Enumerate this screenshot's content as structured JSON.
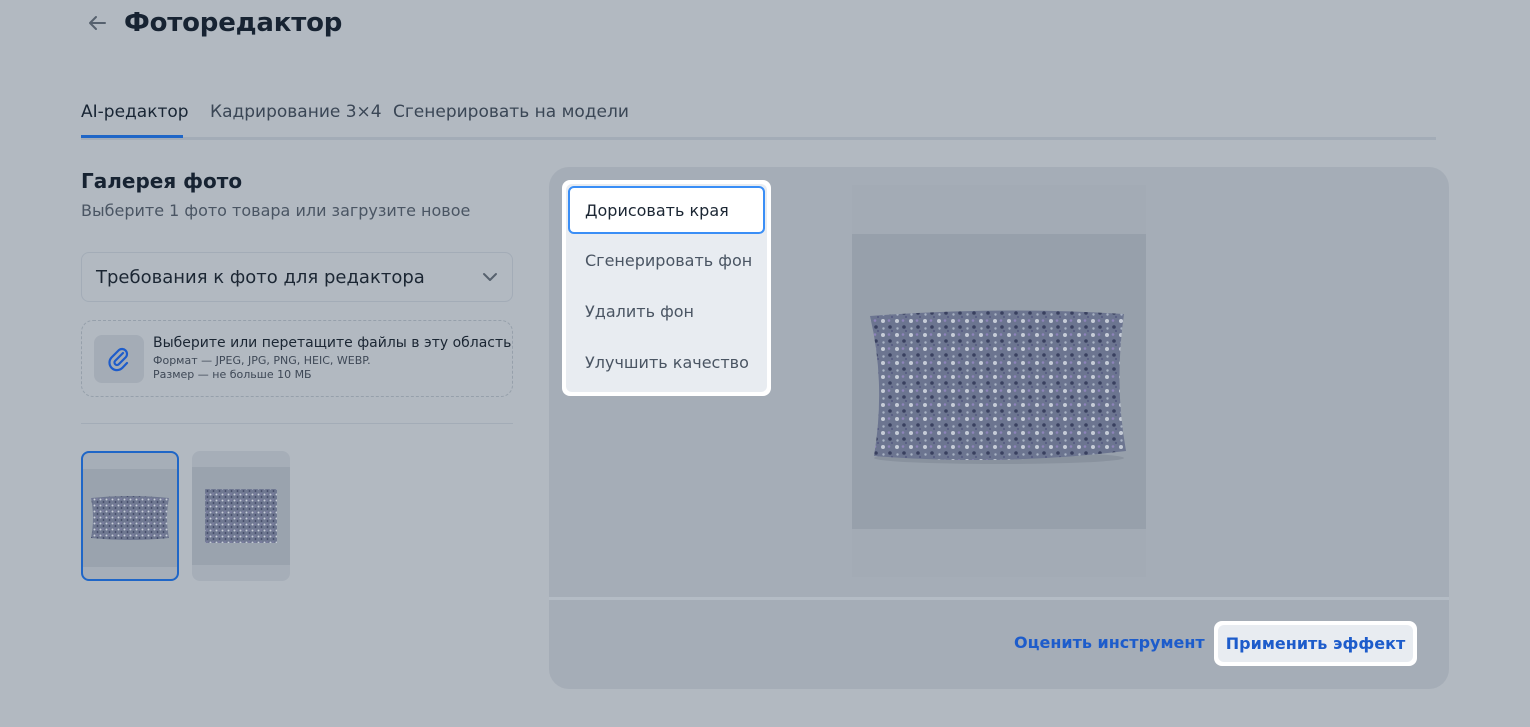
{
  "header": {
    "title": "Фоторедактор",
    "back_icon": "arrow-left-icon"
  },
  "tabs": [
    {
      "label": "AI-редактор",
      "active": true
    },
    {
      "label": "Кадрирование 3×4",
      "active": false
    },
    {
      "label": "Сгенерировать на модели",
      "active": false
    }
  ],
  "gallery": {
    "title": "Галерея фото",
    "subtitle": "Выберите 1 фото товара или загрузите новое",
    "requirements_label": "Требования к фото для редактора",
    "upload": {
      "main": "Выберите или перетащите файлы в эту область",
      "format": "Формат — JPEG, JPG, PNG, HEIC, WEBP.",
      "size": "Размер — не больше 10 МБ"
    },
    "thumbnails": [
      {
        "selected": true
      },
      {
        "selected": false
      }
    ]
  },
  "tools_menu": {
    "items": [
      {
        "label": "Дорисовать края",
        "active": true
      },
      {
        "label": "Сгенерировать фон",
        "active": false
      },
      {
        "label": "Удалить фон",
        "active": false
      },
      {
        "label": "Улучшить качество",
        "active": false
      }
    ]
  },
  "actions": {
    "rate_label": "Оценить инструмент",
    "apply_label": "Применить эффект"
  },
  "colors": {
    "accent": "#1f66c7",
    "link": "#1d5ccb",
    "focus": "#3a8ef6",
    "overlay_bg": "#b2b9c1"
  }
}
